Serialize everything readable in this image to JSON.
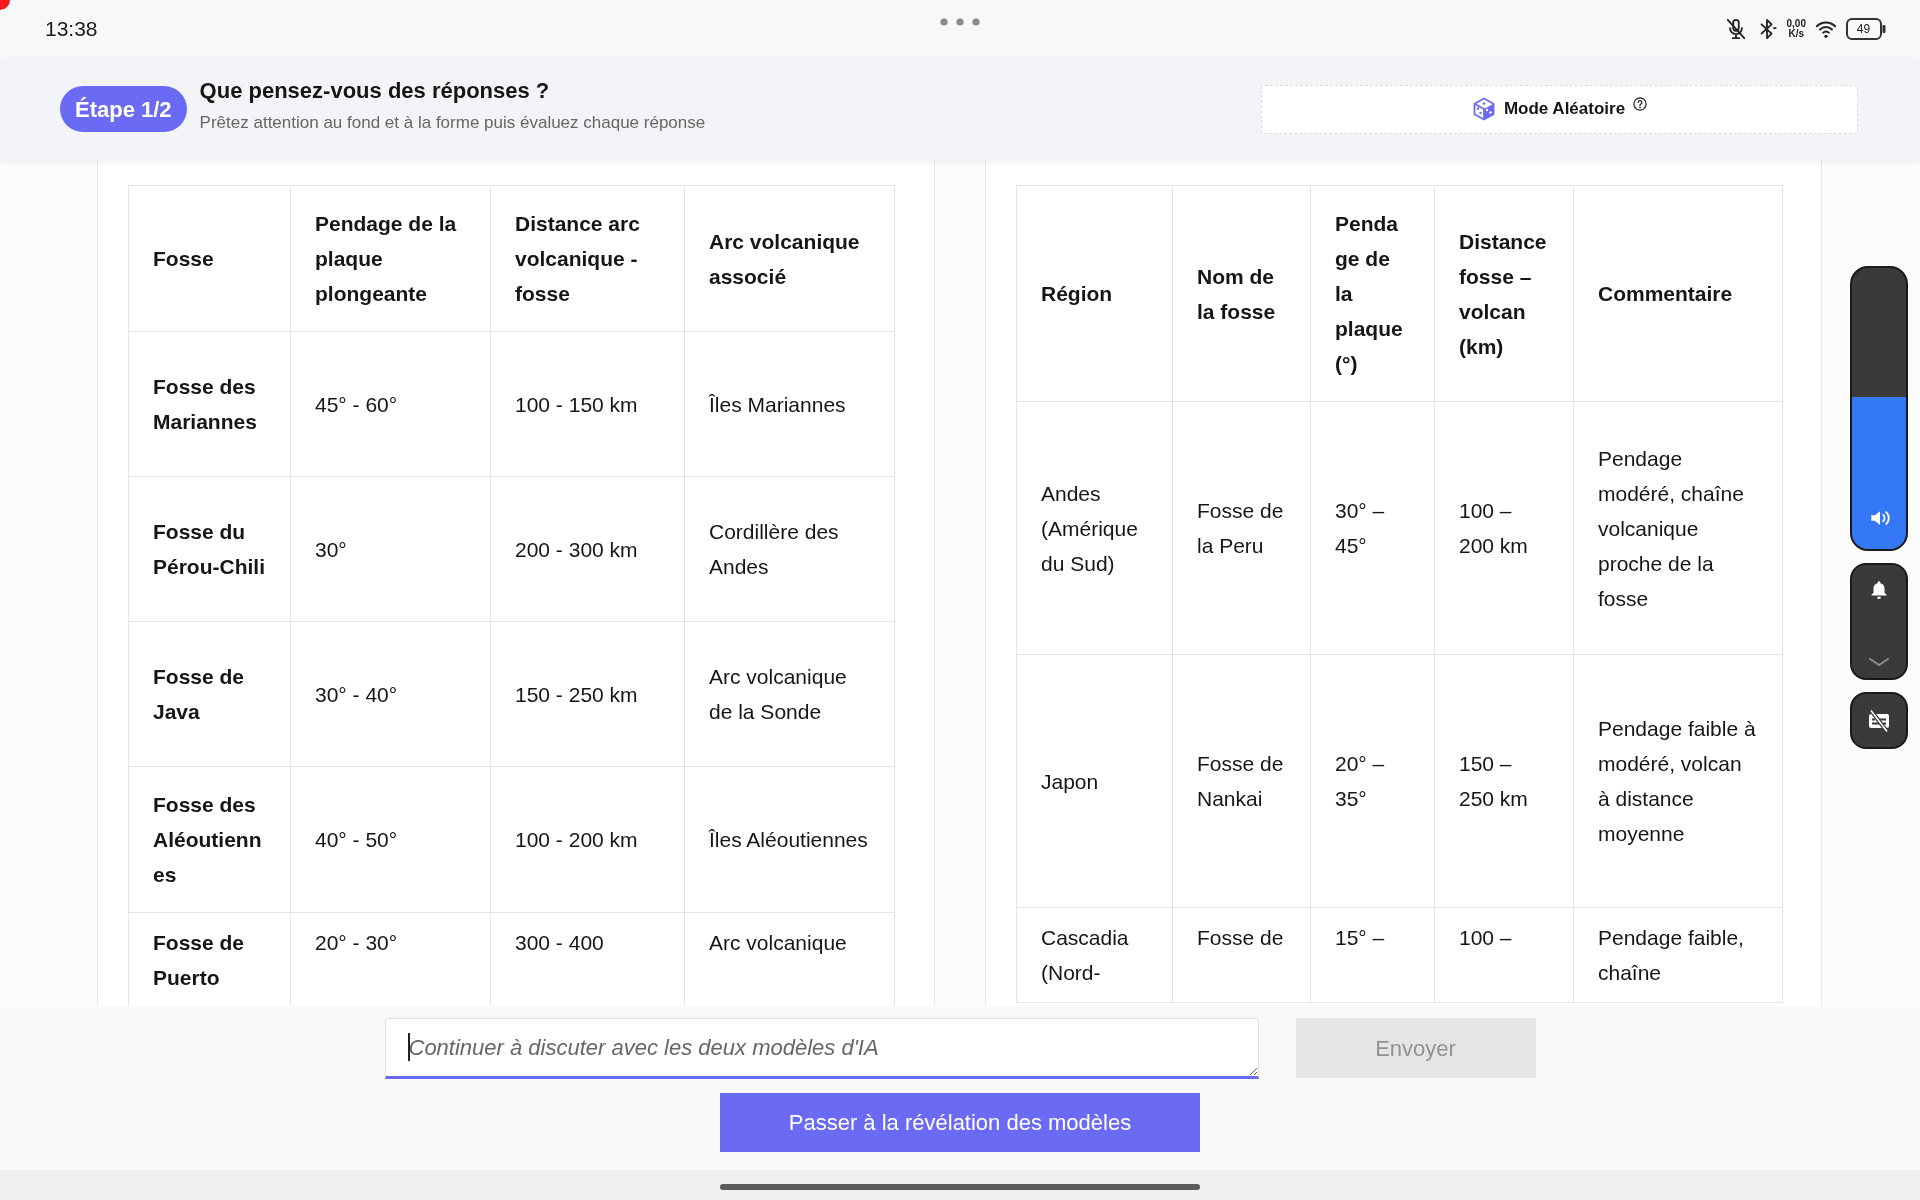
{
  "status_bar": {
    "time": "13:38",
    "network_speed": "0,00",
    "network_speed_unit": "K/s",
    "battery": "49"
  },
  "header": {
    "step_badge": "Étape 1/2",
    "title": "Que pensez-vous des réponses ?",
    "subtitle": "Prêtez attention au fond et à la forme puis évaluez chaque réponse",
    "mode_button": "Mode Aléatoire"
  },
  "response_tables": [
    {
      "row_headers": true,
      "columns": [
        "Fosse",
        "Pendage de la plaque plongeante",
        "Distance arc volcanique - fosse",
        "Arc volcanique associé"
      ],
      "rows": [
        [
          "Fosse des Mariannes",
          "45° - 60°",
          "100 - 150 km",
          "Îles Mariannes"
        ],
        [
          "Fosse du Pérou-Chili",
          "30°",
          "200 - 300 km",
          "Cordillère des Andes"
        ],
        [
          "Fosse de Java",
          "30° - 40°",
          "150 - 250 km",
          "Arc volcanique de la Sonde"
        ],
        [
          "Fosse des Aléoutiennes",
          "40° - 50°",
          "100 - 200 km",
          "Îles Aléoutiennes"
        ],
        [
          "Fosse de Puerto",
          "20° - 30°",
          "300 - 400",
          "Arc volcanique"
        ]
      ]
    },
    {
      "row_headers": false,
      "columns": [
        "Région",
        "Nom de la fosse",
        "Pendage de la plaque (°)",
        "Distance fosse – volcan (km)",
        "Commentaire"
      ],
      "rows": [
        [
          "Andes (Amérique du Sud)",
          "Fosse de la Peru",
          "30° – 45°",
          "100 – 200 km",
          "Pendage modéré, chaîne volcanique proche de la fosse"
        ],
        [
          "Japon",
          "Fosse de Nankai",
          "20° – 35°",
          "150 – 250 km",
          "Pendage faible à modéré, volcan à distance moyenne"
        ],
        [
          "Cascadia (Nord-",
          "Fosse de",
          "15° –",
          "100 –",
          "Pendage faible, chaîne"
        ]
      ]
    }
  ],
  "chat_input": {
    "placeholder": "Continuer à discuter avec les deux modèles d'IA",
    "focused": true
  },
  "send_button": {
    "label": "Envoyer",
    "disabled": true
  },
  "reveal_button": {
    "label": "Passer à la révélation des modèles"
  },
  "volume_slider": {
    "level": 0.54
  }
}
